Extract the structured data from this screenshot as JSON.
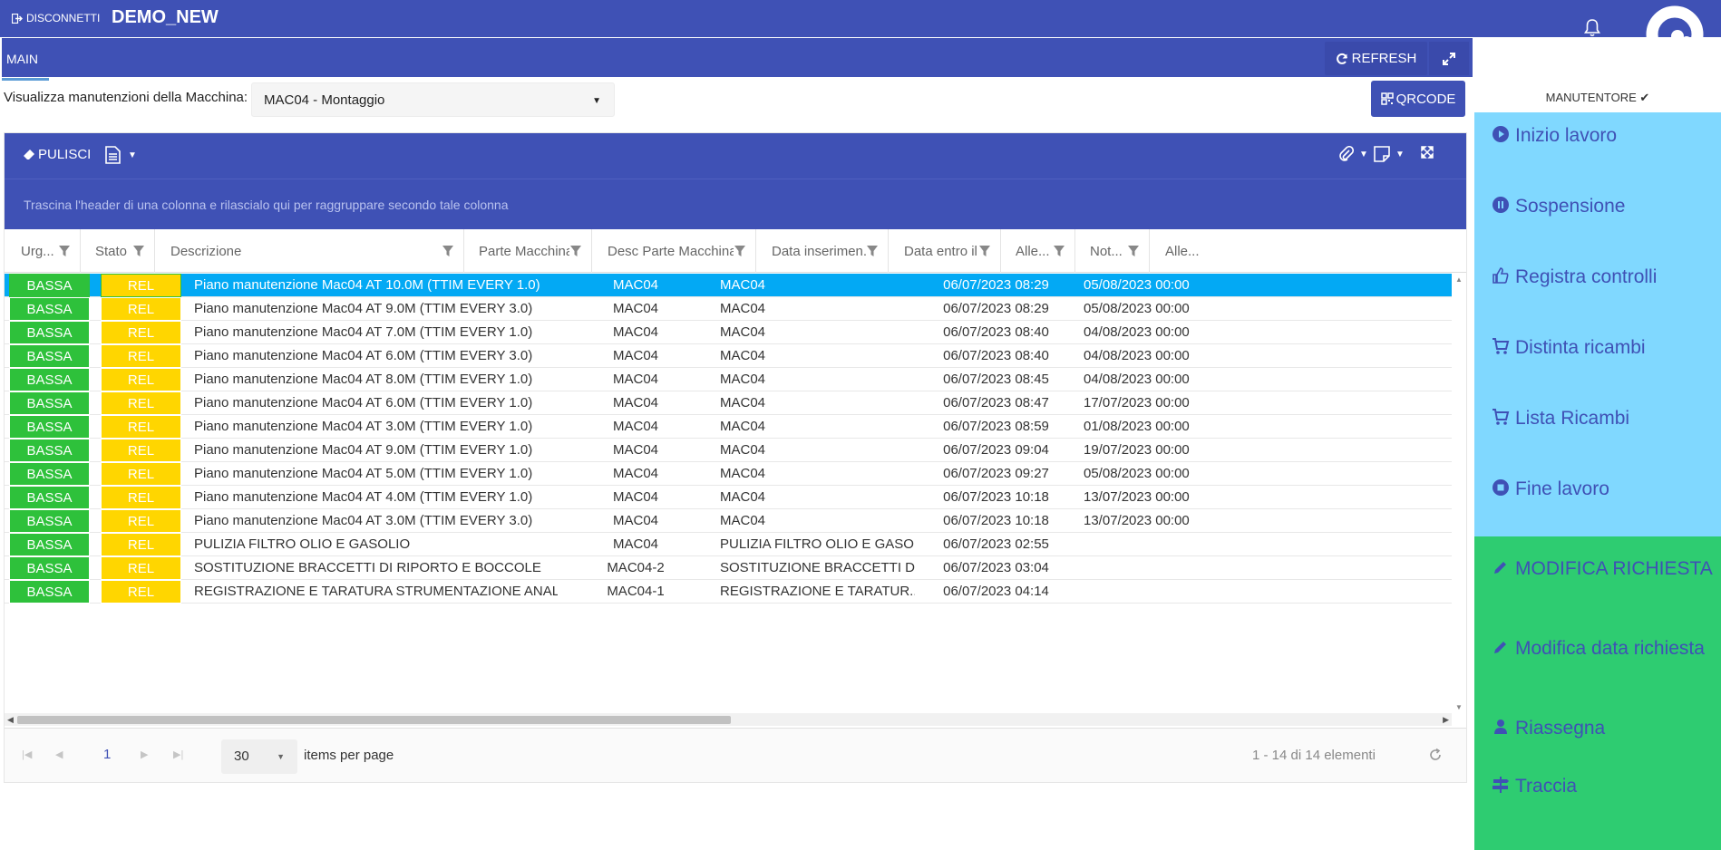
{
  "topbar": {
    "disconnect_label": "DISCONNETTI",
    "app_title": "DEMO_NEW"
  },
  "tabbar": {
    "tab_main": "MAIN",
    "refresh_label": "REFRESH"
  },
  "filter": {
    "machine_label": "Visualizza manutenzioni della Macchina:",
    "machine_value": "MAC04 - Montaggio",
    "qrcode_label": "QRCODE"
  },
  "grid": {
    "toolbar": {
      "pulisci_label": "PULISCI"
    },
    "group_hint": "Trascina l'header di una colonna e rilascialo qui per raggruppare secondo tale colonna",
    "columns": [
      "Urg...",
      "Stato",
      "Descrizione",
      "Parte Macchina",
      "Desc Parte Macchina",
      "Data inserimen...",
      "Data entro il",
      "Alle...",
      "Not...",
      "Alle..."
    ],
    "rows": [
      {
        "urg": "BASSA",
        "stato": "REL",
        "desc": "Piano manutenzione Mac04 AT 10.0M (TTIM EVERY 1.0)",
        "parte": "MAC04",
        "descparte": "MAC04",
        "datains": "06/07/2023 08:29",
        "dataentro": "05/08/2023 00:00"
      },
      {
        "urg": "BASSA",
        "stato": "REL",
        "desc": "Piano manutenzione Mac04 AT 9.0M (TTIM EVERY 3.0)",
        "parte": "MAC04",
        "descparte": "MAC04",
        "datains": "06/07/2023 08:29",
        "dataentro": "05/08/2023 00:00"
      },
      {
        "urg": "BASSA",
        "stato": "REL",
        "desc": "Piano manutenzione Mac04 AT 7.0M (TTIM EVERY 1.0)",
        "parte": "MAC04",
        "descparte": "MAC04",
        "datains": "06/07/2023 08:40",
        "dataentro": "04/08/2023 00:00"
      },
      {
        "urg": "BASSA",
        "stato": "REL",
        "desc": "Piano manutenzione Mac04 AT 6.0M (TTIM EVERY 3.0)",
        "parte": "MAC04",
        "descparte": "MAC04",
        "datains": "06/07/2023 08:40",
        "dataentro": "04/08/2023 00:00"
      },
      {
        "urg": "BASSA",
        "stato": "REL",
        "desc": "Piano manutenzione Mac04 AT 8.0M (TTIM EVERY 1.0)",
        "parte": "MAC04",
        "descparte": "MAC04",
        "datains": "06/07/2023 08:45",
        "dataentro": "04/08/2023 00:00"
      },
      {
        "urg": "BASSA",
        "stato": "REL",
        "desc": "Piano manutenzione Mac04 AT 6.0M (TTIM EVERY 1.0)",
        "parte": "MAC04",
        "descparte": "MAC04",
        "datains": "06/07/2023 08:47",
        "dataentro": "17/07/2023 00:00"
      },
      {
        "urg": "BASSA",
        "stato": "REL",
        "desc": "Piano manutenzione Mac04 AT 3.0M (TTIM EVERY 1.0)",
        "parte": "MAC04",
        "descparte": "MAC04",
        "datains": "06/07/2023 08:59",
        "dataentro": "01/08/2023 00:00"
      },
      {
        "urg": "BASSA",
        "stato": "REL",
        "desc": "Piano manutenzione Mac04 AT 9.0M (TTIM EVERY 1.0)",
        "parte": "MAC04",
        "descparte": "MAC04",
        "datains": "06/07/2023 09:04",
        "dataentro": "19/07/2023 00:00"
      },
      {
        "urg": "BASSA",
        "stato": "REL",
        "desc": "Piano manutenzione Mac04 AT 5.0M (TTIM EVERY 1.0)",
        "parte": "MAC04",
        "descparte": "MAC04",
        "datains": "06/07/2023 09:27",
        "dataentro": "05/08/2023 00:00"
      },
      {
        "urg": "BASSA",
        "stato": "REL",
        "desc": "Piano manutenzione Mac04 AT 4.0M (TTIM EVERY 1.0)",
        "parte": "MAC04",
        "descparte": "MAC04",
        "datains": "06/07/2023 10:18",
        "dataentro": "13/07/2023 00:00"
      },
      {
        "urg": "BASSA",
        "stato": "REL",
        "desc": "Piano manutenzione Mac04 AT 3.0M (TTIM EVERY 3.0)",
        "parte": "MAC04",
        "descparte": "MAC04",
        "datains": "06/07/2023 10:18",
        "dataentro": "13/07/2023 00:00"
      },
      {
        "urg": "BASSA",
        "stato": "REL",
        "desc": "PULIZIA FILTRO OLIO E GASOLIO",
        "parte": "MAC04",
        "descparte": "PULIZIA FILTRO OLIO E GASO...",
        "datains": "06/07/2023 02:55",
        "dataentro": ""
      },
      {
        "urg": "BASSA",
        "stato": "REL",
        "desc": "SOSTITUZIONE BRACCETTI DI RIPORTO E BOCCOLE",
        "parte": "MAC04-2",
        "descparte": "SOSTITUZIONE BRACCETTI D...",
        "datains": "06/07/2023 03:04",
        "dataentro": ""
      },
      {
        "urg": "BASSA",
        "stato": "REL",
        "desc": "REGISTRAZIONE E TARATURA STRUMENTAZIONE ANALO...",
        "parte": "MAC04-1",
        "descparte": "REGISTRAZIONE E TARATUR...",
        "datains": "06/07/2023 04:14",
        "dataentro": ""
      }
    ],
    "pager": {
      "current_page": "1",
      "page_size": "30",
      "items_per_page_label": "items per page",
      "info": "1 - 14 di 14 elementi"
    }
  },
  "sidebar": {
    "role": "MANUTENTORE ✔",
    "actions_top": [
      "Inizio lavoro",
      "Sospensione",
      "Registra controlli",
      "Distinta ricambi",
      "Lista Ricambi",
      "Fine lavoro"
    ],
    "actions_bottom": [
      "MODIFICA RICHIESTA",
      "Modifica data richiesta",
      "Riassegna",
      "Traccia"
    ]
  },
  "colors": {
    "primary": "#3f51b5",
    "selected_row": "#03a9f4",
    "urgency_green": "#2ec13b",
    "status_yellow": "#ffd600",
    "sidebar_light_blue": "#80d8ff",
    "sidebar_green": "#2ecc71"
  }
}
